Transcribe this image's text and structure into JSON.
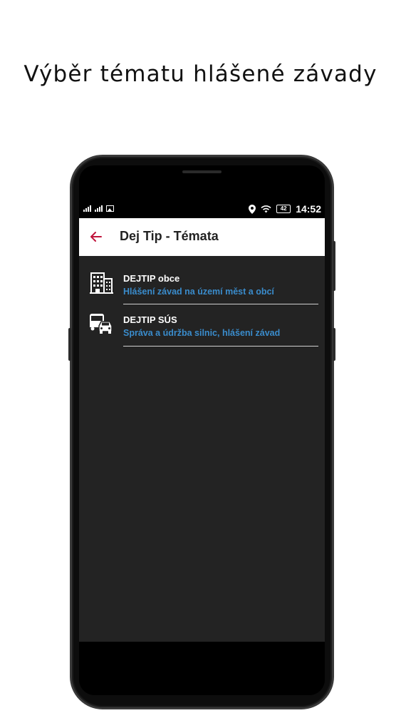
{
  "caption": "Výběr tématu hlášené závady",
  "status_bar": {
    "time": "14:52",
    "battery": "42",
    "icons": [
      "signal-icon",
      "signal-icon",
      "image-icon",
      "location-icon",
      "wifi-icon",
      "battery-icon"
    ]
  },
  "app_bar": {
    "title": "Dej Tip - Témata",
    "back_icon": "arrow-left-icon",
    "accent_color": "#c0143c"
  },
  "topics": [
    {
      "icon": "building-icon",
      "title": "DEJTIP obce",
      "subtitle": "Hlášení závad na území měst a obcí"
    },
    {
      "icon": "vehicles-icon",
      "title": "DEJTIP SÚS",
      "subtitle": "Správa a údržba silnic, hlášení závad"
    }
  ],
  "colors": {
    "list_background": "#232323",
    "subtitle": "#3a8ccc",
    "title": "#ffffff"
  }
}
